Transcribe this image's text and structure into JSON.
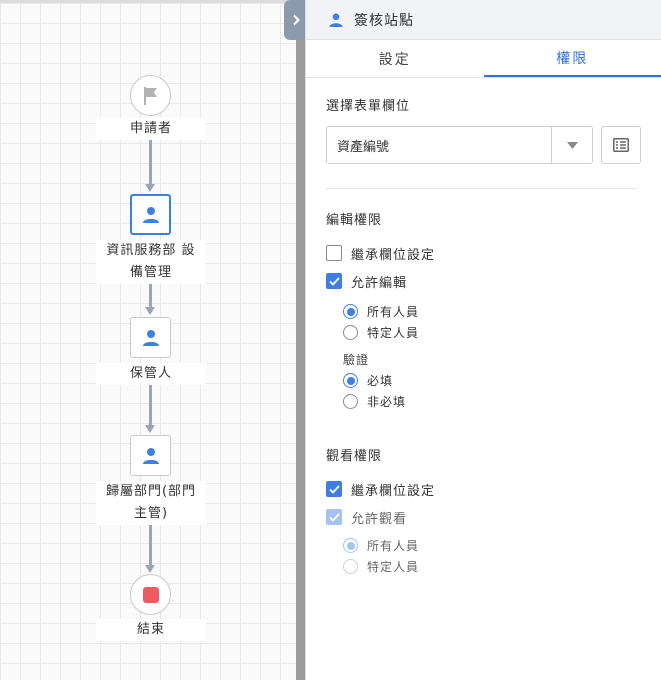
{
  "flow": {
    "nodes": [
      {
        "label": "申請者",
        "kind": "start"
      },
      {
        "label": "資訊服務部 設\n備管理",
        "kind": "approver",
        "selected": true
      },
      {
        "label": "保管人",
        "kind": "approver"
      },
      {
        "label": "歸屬部門(部門\n主管)",
        "kind": "approver"
      },
      {
        "label": "結束",
        "kind": "end"
      }
    ],
    "colors": {
      "selected": "#3f7fe0",
      "connector": "#9aa6b8",
      "stop": "#f05a63",
      "icon": "#3f7fe0"
    }
  },
  "panel": {
    "title": "簽核站點",
    "tabs": [
      {
        "label": "設定",
        "active": false
      },
      {
        "label": "權限",
        "active": true
      }
    ],
    "field_select": {
      "label": "選擇表單欄位",
      "value": "資產編號"
    },
    "edit_permission": {
      "title": "編輯權限",
      "inherit_label": "繼承欄位設定",
      "inherit_checked": false,
      "allow_label": "允許編輯",
      "allow_checked": true,
      "scope_options": [
        "所有人員",
        "特定人員"
      ],
      "scope_selected": "所有人員",
      "validation_title": "驗證",
      "validation_options": [
        "必填",
        "非必填"
      ],
      "validation_selected": "必填"
    },
    "view_permission": {
      "title": "觀看權限",
      "inherit_label": "繼承欄位設定",
      "inherit_checked": true,
      "allow_label": "允許觀看",
      "allow_checked": true,
      "scope_options": [
        "所有人員",
        "特定人員"
      ],
      "scope_selected": "所有人員"
    }
  },
  "icons": [
    "flag-icon",
    "user-icon",
    "stop-icon",
    "chevron-right-icon",
    "caret-down-icon",
    "list-icon",
    "check-icon"
  ]
}
